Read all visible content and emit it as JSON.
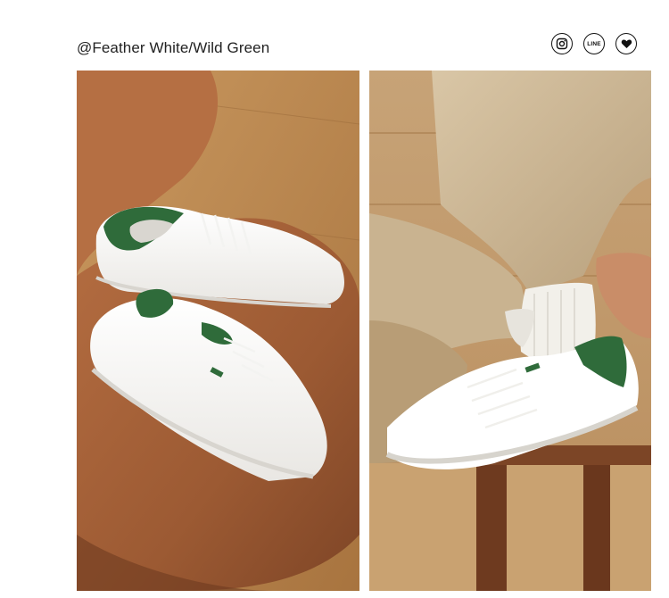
{
  "header": {
    "title": "@Feather White/Wild Green"
  },
  "social": [
    {
      "icon": "instagram-icon"
    },
    {
      "icon": "line-icon",
      "label": "LINE"
    },
    {
      "icon": "heart-icon"
    }
  ],
  "colors": {
    "accent_green": "#2f6b3a",
    "wood": "#b7834f",
    "leather": "#b06a3f",
    "trouser_beige": "#cdb797"
  },
  "photos": [
    {
      "name": "sneakers-on-leather-chair"
    },
    {
      "name": "sneaker-on-foot-with-beige-trousers"
    }
  ]
}
